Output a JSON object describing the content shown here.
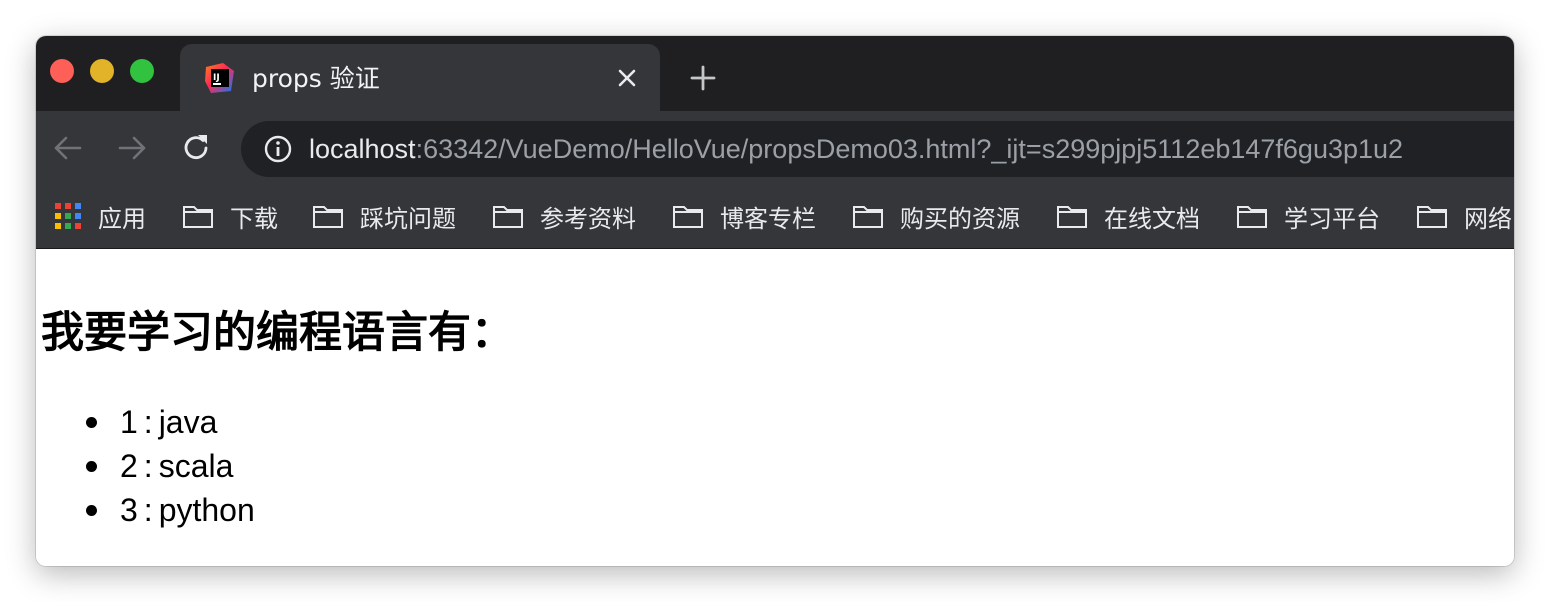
{
  "tab": {
    "title": "props 验证"
  },
  "address_bar": {
    "host": "localhost",
    "rest": ":63342/VueDemo/HelloVue/propsDemo03.html?_ijt=s299pjpj5112eb147f6gu3p1u2"
  },
  "bookmarks": {
    "apps_label": "应用",
    "folders": [
      "下载",
      "踩坑问题",
      "参考资料",
      "博客专栏",
      "购买的资源",
      "在线文档",
      "学习平台",
      "网络"
    ]
  },
  "page": {
    "heading": "我要学习的编程语言有：",
    "languages": [
      {
        "index": "1",
        "name": "java"
      },
      {
        "index": "2",
        "name": "scala"
      },
      {
        "index": "3",
        "name": "python"
      }
    ],
    "separator": ":"
  },
  "colors": {
    "traffic_close": "#fe5f57",
    "traffic_minimize": "#e2b229",
    "traffic_maximize": "#31c23f",
    "chrome_dark": "#35363a",
    "url_muted": "#9aa0a6"
  },
  "icons": [
    "intellij-icon",
    "close-icon",
    "plus-icon",
    "back-arrow-icon",
    "forward-arrow-icon",
    "reload-icon",
    "info-icon",
    "apps-grid-icon",
    "folder-icon"
  ]
}
